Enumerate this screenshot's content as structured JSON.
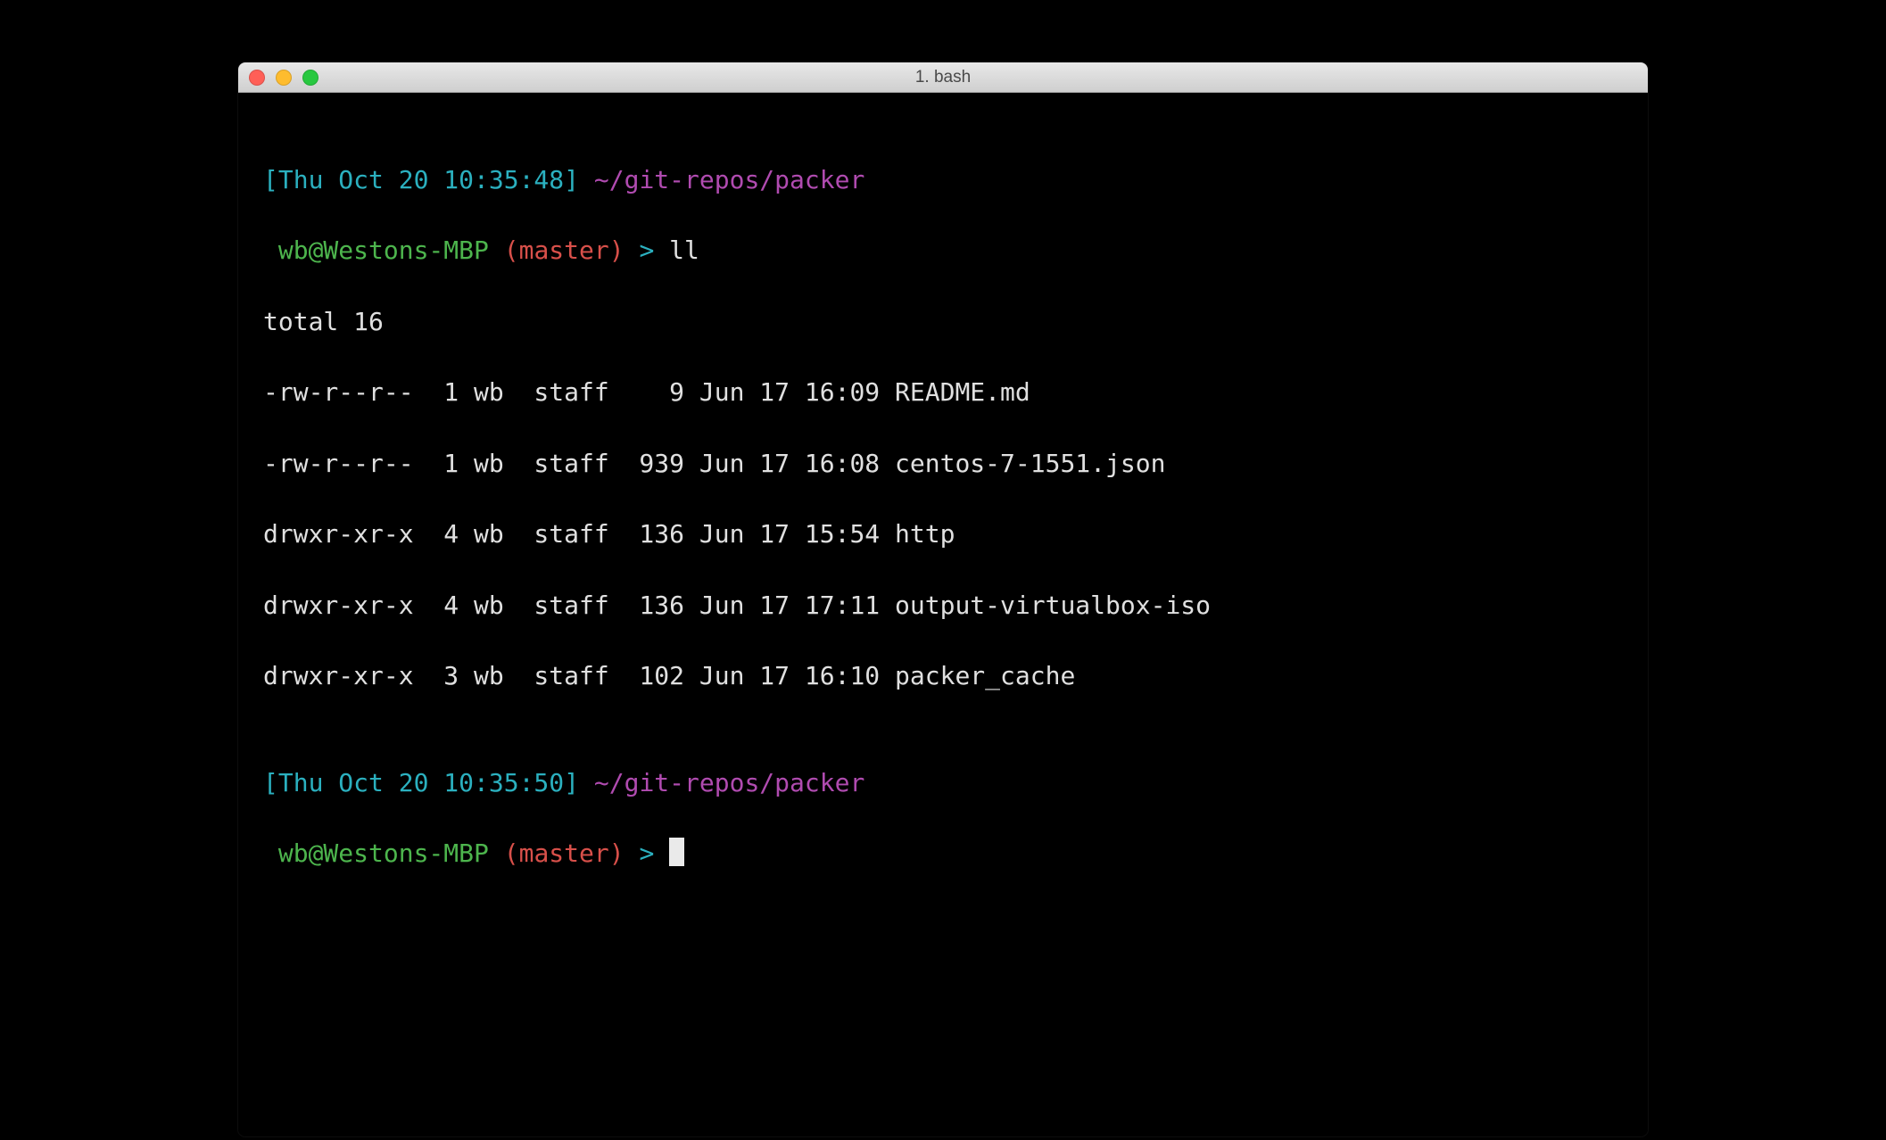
{
  "window": {
    "title": "1. bash"
  },
  "prompt1": {
    "timestamp": "[Thu Oct 20 10:35:48]",
    "path": "~/git-repos/packer",
    "userhost": "wb@Westons-MBP",
    "branch": "(master)",
    "arrow": ">",
    "command": "ll"
  },
  "output": {
    "total": "total 16",
    "rows": [
      "-rw-r--r--  1 wb  staff    9 Jun 17 16:09 README.md",
      "-rw-r--r--  1 wb  staff  939 Jun 17 16:08 centos-7-1551.json",
      "drwxr-xr-x  4 wb  staff  136 Jun 17 15:54 http",
      "drwxr-xr-x  4 wb  staff  136 Jun 17 17:11 output-virtualbox-iso",
      "drwxr-xr-x  3 wb  staff  102 Jun 17 16:10 packer_cache"
    ]
  },
  "prompt2": {
    "timestamp": "[Thu Oct 20 10:35:50]",
    "path": "~/git-repos/packer",
    "userhost": "wb@Westons-MBP",
    "branch": "(master)",
    "arrow": ">"
  }
}
